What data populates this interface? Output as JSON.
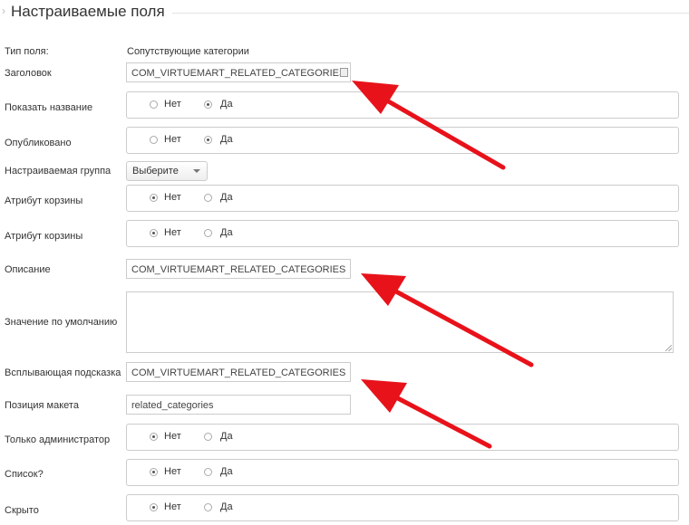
{
  "section": {
    "title": "Настраиваемые поля"
  },
  "rows": {
    "type": {
      "label": "Тип поля:",
      "value": "Сопутствующие категории"
    },
    "title": {
      "label": "Заголовок",
      "value": "COM_VIRTUEMART_RELATED_CATEGORIES"
    },
    "show_title": {
      "label": "Показать название",
      "no": "Нет",
      "yes": "Да",
      "selected": "yes"
    },
    "published": {
      "label": "Опубликовано",
      "no": "Нет",
      "yes": "Да",
      "selected": "yes"
    },
    "custom_group": {
      "label": "Настраиваемая группа",
      "selected": "Выберите"
    },
    "cart_attr_1": {
      "label": "Атрибут корзины",
      "no": "Нет",
      "yes": "Да",
      "selected": "no"
    },
    "cart_attr_2": {
      "label": "Атрибут корзины",
      "no": "Нет",
      "yes": "Да",
      "selected": "no"
    },
    "description": {
      "label": "Описание",
      "value": "COM_VIRTUEMART_RELATED_CATEGORIES"
    },
    "default_value": {
      "label": "Значение по умолчанию",
      "value": ""
    },
    "tooltip": {
      "label": "Всплывающая подсказка",
      "value": "COM_VIRTUEMART_RELATED_CATEGORIES"
    },
    "layout_pos": {
      "label": "Позиция макета",
      "value": "related_categories"
    },
    "admin_only": {
      "label": "Только администратор",
      "no": "Нет",
      "yes": "Да",
      "selected": "no"
    },
    "is_list": {
      "label": "Список?",
      "no": "Нет",
      "yes": "Да",
      "selected": "no"
    },
    "hidden": {
      "label": "Скрыто",
      "no": "Нет",
      "yes": "Да",
      "selected": "no"
    }
  },
  "colors": {
    "annotation_arrow": "#e8121a",
    "border": "#cccccc"
  },
  "icons": {
    "section_chevron": "chevron-right-icon",
    "field_helper": "editor-icon",
    "select_arrow": "chevron-down-icon"
  }
}
